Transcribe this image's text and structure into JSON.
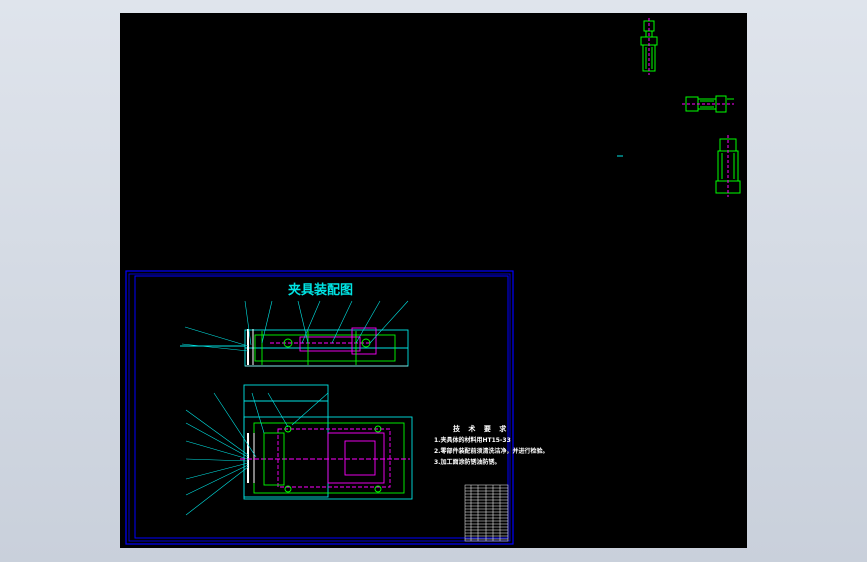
{
  "drawing": {
    "title": "夹具装配图",
    "notes_heading": "技 术 要 求",
    "notes": [
      "1.夹具体的材料用HT15-33",
      "2.零部件装配前须清洗洁净，并进行检验。",
      "3.加工面涂防锈油防锈。"
    ]
  },
  "colors": {
    "background": "#000000",
    "border": "#0000ff",
    "cyan": "#00e5e5",
    "green": "#00ff00",
    "magenta": "#ff00ff",
    "white": "#ffffff"
  }
}
